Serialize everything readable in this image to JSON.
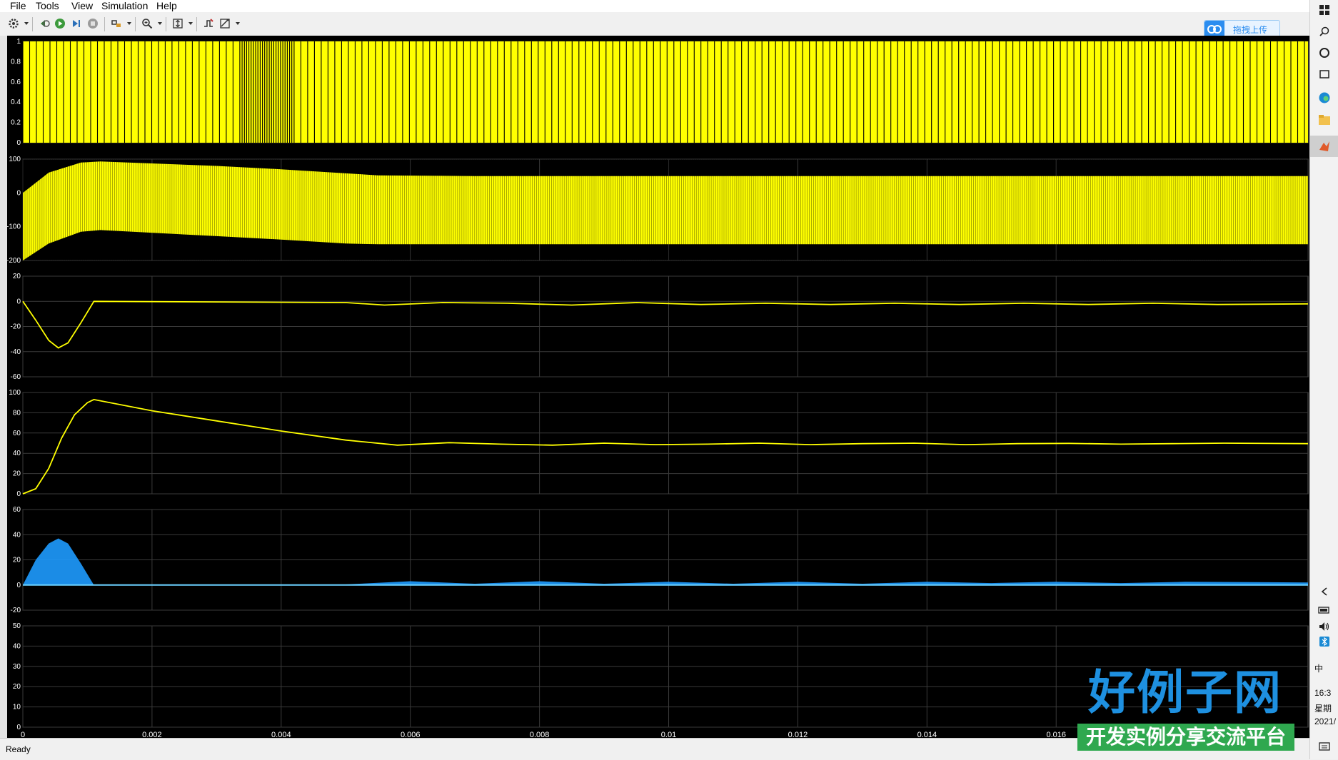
{
  "menu": [
    "File",
    "Tools",
    "View",
    "Simulation",
    "Help"
  ],
  "toolbar_icons": [
    "settings-icon",
    "restore-icon",
    "run-icon",
    "step-forward-icon",
    "stop-icon",
    "highlight-icon",
    "zoom-icon",
    "autoscale-icon",
    "triggers-icon",
    "cursor-measure-icon"
  ],
  "upload_button": {
    "label": "拖拽上传"
  },
  "status": {
    "text": "Ready"
  },
  "taskbar": {
    "ime": "中",
    "time": "16:3",
    "day": "星期",
    "date": "2021/"
  },
  "watermark": {
    "title": "好例子网",
    "subtitle": "开发实例分享交流平台"
  },
  "colors": {
    "trace_yellow": "#ffff00",
    "trace_blue": "#1e9bff",
    "background": "#000000",
    "grid": "#3a3a3a"
  },
  "chart_data": {
    "type": "line",
    "x_ticks": [
      "0",
      "0.002",
      "0.004",
      "0.006",
      "0.008",
      "0.01",
      "0.012",
      "0.014",
      "0.016"
    ],
    "xlim": [
      0,
      0.0199
    ],
    "grid": true,
    "axes": [
      {
        "yticks": [
          "0",
          "0.2",
          "0.4",
          "0.6",
          "0.8",
          "1"
        ],
        "ylim": [
          0,
          1
        ],
        "style": "pwm",
        "color": "#ffff00",
        "note_values": {
          "low": 0,
          "high": 1
        }
      },
      {
        "yticks": [
          "-200",
          "-100",
          "0",
          "100"
        ],
        "ylim": [
          -200,
          100
        ],
        "style": "band",
        "color": "#ffff00",
        "upper_env": [
          [
            0,
            0
          ],
          [
            0.0004,
            60
          ],
          [
            0.0009,
            90
          ],
          [
            0.0012,
            93
          ],
          [
            0.003,
            80
          ],
          [
            0.004,
            70
          ],
          [
            0.005,
            58
          ],
          [
            0.0055,
            52
          ],
          [
            0.007,
            50
          ],
          [
            0.0199,
            50
          ]
        ],
        "lower_env": [
          [
            0,
            -200
          ],
          [
            0.0004,
            -150
          ],
          [
            0.0009,
            -115
          ],
          [
            0.0012,
            -110
          ],
          [
            0.003,
            -128
          ],
          [
            0.004,
            -138
          ],
          [
            0.005,
            -150
          ],
          [
            0.0055,
            -152
          ],
          [
            0.007,
            -152
          ],
          [
            0.0199,
            -152
          ]
        ]
      },
      {
        "yticks": [
          "-60",
          "-40",
          "-20",
          "0",
          "20"
        ],
        "ylim": [
          -60,
          20
        ],
        "style": "line",
        "color": "#ffff00",
        "points": [
          [
            0,
            0
          ],
          [
            0.0002,
            -15
          ],
          [
            0.0004,
            -31
          ],
          [
            0.00055,
            -37
          ],
          [
            0.0007,
            -33
          ],
          [
            0.0009,
            -17
          ],
          [
            0.0011,
            0
          ],
          [
            0.005,
            -1
          ],
          [
            0.0056,
            -3
          ],
          [
            0.0065,
            -1
          ],
          [
            0.0075,
            -1.5
          ],
          [
            0.0085,
            -3
          ],
          [
            0.0095,
            -1
          ],
          [
            0.0105,
            -2.5
          ],
          [
            0.0115,
            -1.5
          ],
          [
            0.0125,
            -2.5
          ],
          [
            0.0135,
            -1.5
          ],
          [
            0.0145,
            -2.5
          ],
          [
            0.0155,
            -1.5
          ],
          [
            0.0165,
            -2.5
          ],
          [
            0.0175,
            -1.5
          ],
          [
            0.0185,
            -2.5
          ],
          [
            0.0199,
            -2
          ]
        ]
      },
      {
        "yticks": [
          "0",
          "20",
          "40",
          "60",
          "80",
          "100"
        ],
        "ylim": [
          0,
          100
        ],
        "style": "line",
        "color": "#ffff00",
        "points": [
          [
            0,
            0
          ],
          [
            0.0002,
            5
          ],
          [
            0.0004,
            25
          ],
          [
            0.0006,
            55
          ],
          [
            0.0008,
            78
          ],
          [
            0.001,
            90
          ],
          [
            0.0011,
            93
          ],
          [
            0.002,
            82
          ],
          [
            0.003,
            72
          ],
          [
            0.004,
            62
          ],
          [
            0.005,
            53
          ],
          [
            0.0058,
            48
          ],
          [
            0.0066,
            50.5
          ],
          [
            0.0074,
            49
          ],
          [
            0.0082,
            48
          ],
          [
            0.009,
            50
          ],
          [
            0.0098,
            48.5
          ],
          [
            0.0106,
            49
          ],
          [
            0.0114,
            50
          ],
          [
            0.0122,
            48.5
          ],
          [
            0.013,
            49.5
          ],
          [
            0.0138,
            50
          ],
          [
            0.0146,
            48.5
          ],
          [
            0.0154,
            49.5
          ],
          [
            0.0162,
            49.8
          ],
          [
            0.017,
            49
          ],
          [
            0.0178,
            49.5
          ],
          [
            0.0186,
            50
          ],
          [
            0.0199,
            49.5
          ]
        ]
      },
      {
        "yticks": [
          "-20",
          "0",
          "20",
          "40",
          "60"
        ],
        "ylim": [
          -20,
          60
        ],
        "style": "fill",
        "color": "#1e9bff",
        "points": [
          [
            0,
            0
          ],
          [
            0.0002,
            20
          ],
          [
            0.0004,
            33
          ],
          [
            0.00055,
            37
          ],
          [
            0.0007,
            33
          ],
          [
            0.0009,
            17
          ],
          [
            0.0011,
            0
          ],
          [
            0.005,
            0.5
          ],
          [
            0.006,
            3
          ],
          [
            0.007,
            1
          ],
          [
            0.008,
            3
          ],
          [
            0.009,
            1
          ],
          [
            0.01,
            2.5
          ],
          [
            0.011,
            1
          ],
          [
            0.012,
            2.5
          ],
          [
            0.013,
            1
          ],
          [
            0.014,
            2.5
          ],
          [
            0.015,
            1.5
          ],
          [
            0.016,
            2.5
          ],
          [
            0.017,
            1.5
          ],
          [
            0.018,
            2.5
          ],
          [
            0.0199,
            2
          ]
        ]
      },
      {
        "yticks": [
          "0",
          "10",
          "20",
          "30",
          "40",
          "50"
        ],
        "ylim": [
          0,
          50
        ],
        "style": "empty",
        "color": "#ffff00"
      }
    ]
  }
}
